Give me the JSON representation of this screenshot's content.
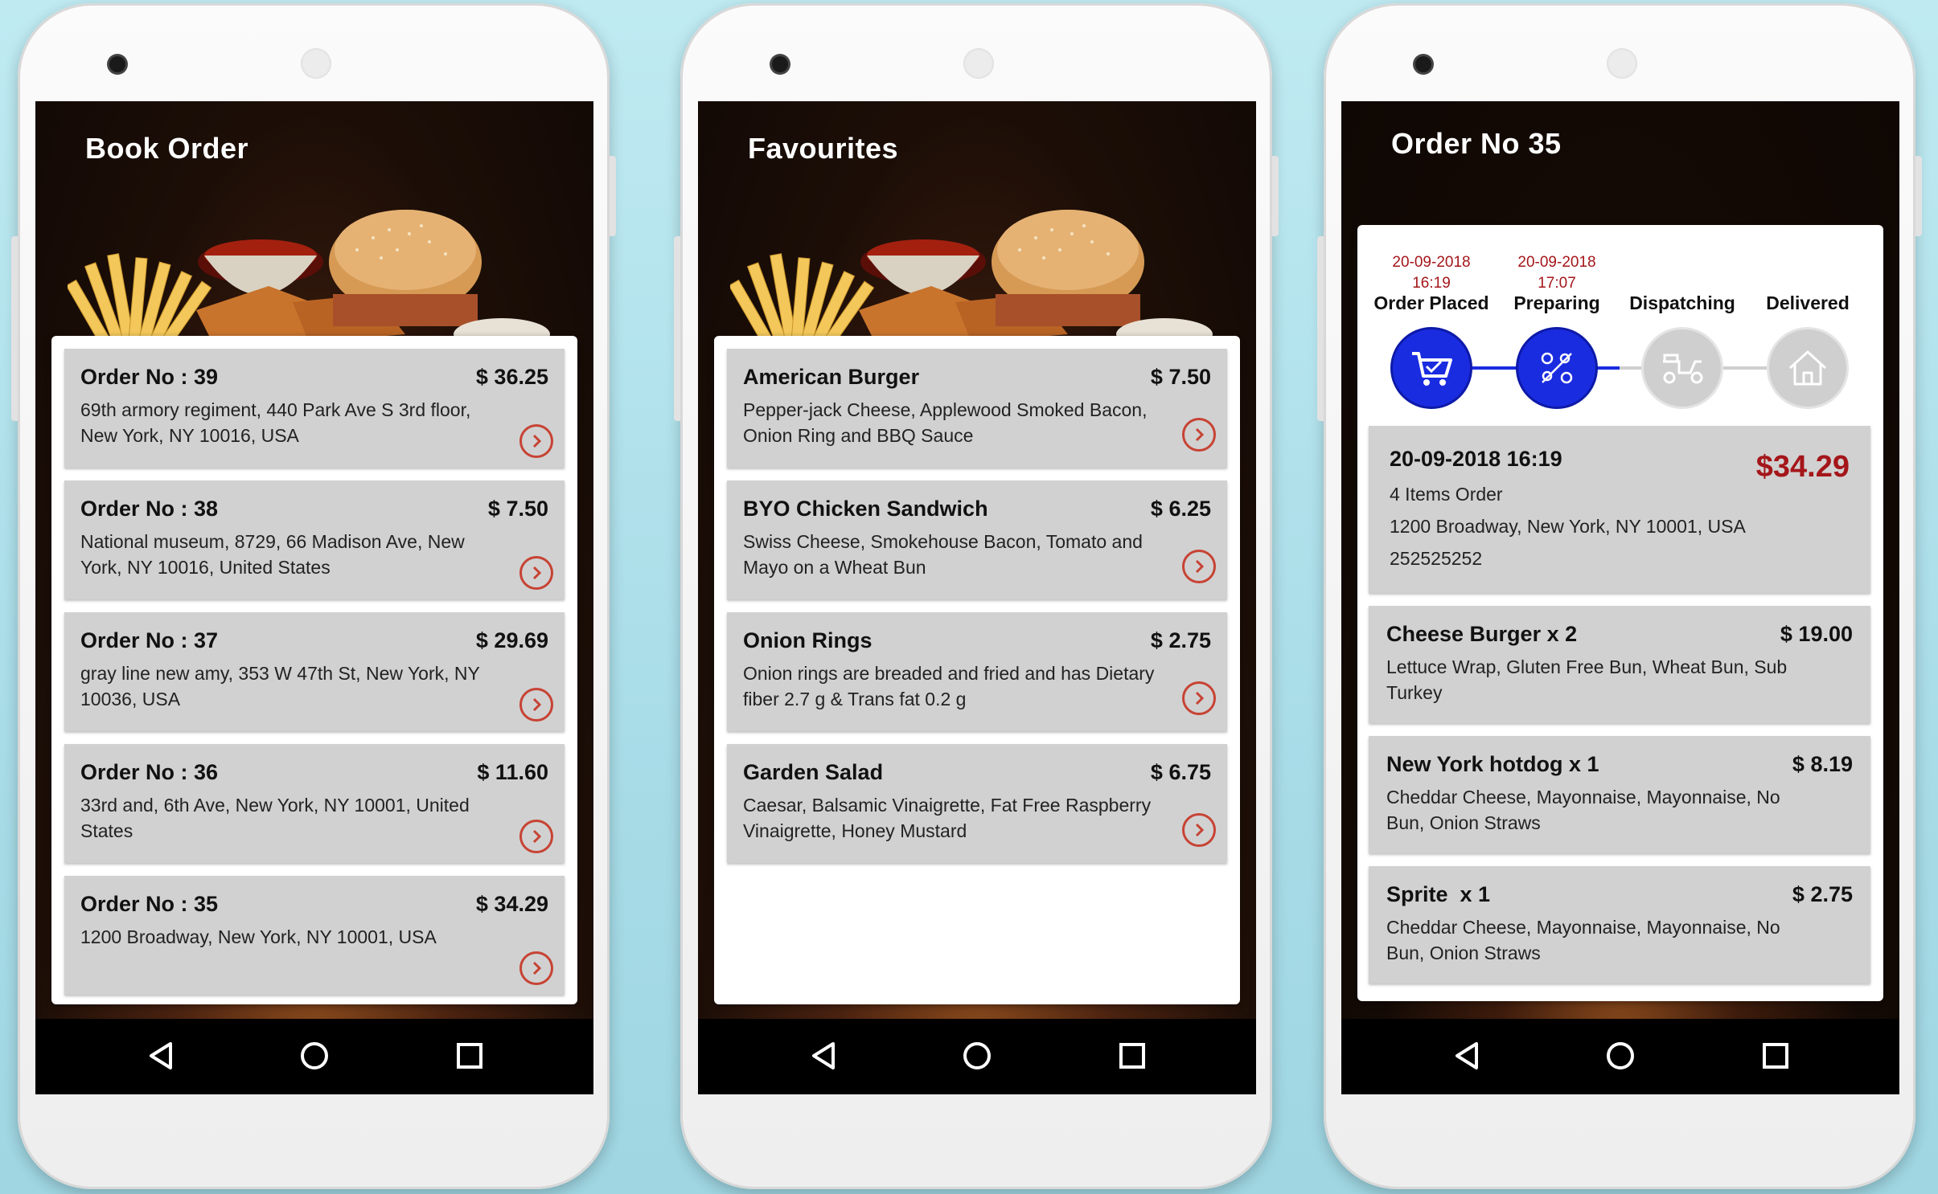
{
  "screens": {
    "book_order": {
      "title": "Book Order",
      "orders": [
        {
          "title": "Order No : 39",
          "price": "$ 36.25",
          "address": "69th armory regiment, 440 Park Ave S 3rd floor, New York, NY 10016, USA"
        },
        {
          "title": "Order No : 38",
          "price": "$ 7.50",
          "address": "National museum, 8729, 66 Madison Ave, New York, NY 10016, United States"
        },
        {
          "title": "Order No : 37",
          "price": "$ 29.69",
          "address": "gray line new amy, 353 W 47th St, New York, NY 10036, USA"
        },
        {
          "title": "Order No : 36",
          "price": "$ 11.60",
          "address": "33rd and, 6th Ave, New York, NY 10001, United States"
        },
        {
          "title": "Order No : 35",
          "price": "$ 34.29",
          "address": "1200 Broadway, New York, NY 10001, USA"
        }
      ]
    },
    "favourites": {
      "title": "Favourites",
      "items": [
        {
          "title": "American Burger",
          "price": "$ 7.50",
          "desc": "Pepper-jack Cheese, Applewood Smoked Bacon, Onion Ring and BBQ Sauce"
        },
        {
          "title": "BYO Chicken Sandwich",
          "price": "$ 6.25",
          "desc": "Swiss Cheese, Smokehouse Bacon, Tomato and Mayo on a Wheat Bun"
        },
        {
          "title": "Onion Rings",
          "price": "$ 2.75",
          "desc": "Onion rings are breaded and fried and has Dietary fiber 2.7 g & Trans fat 0.2 g"
        },
        {
          "title": "Garden Salad",
          "price": "$ 6.75",
          "desc": "Caesar, Balsamic Vinaigrette, Fat Free Raspberry Vinaigrette, Honey Mustard"
        }
      ]
    },
    "order_detail": {
      "title": "Order No 35",
      "steps": [
        {
          "date": "20-09-2018",
          "time": "16:19",
          "label": "Order Placed",
          "state": "done",
          "icon": "cart-icon"
        },
        {
          "date": "20-09-2018",
          "time": "17:07",
          "label": "Preparing",
          "state": "done",
          "icon": "cooking-icon"
        },
        {
          "date": "",
          "time": "",
          "label": "Dispatching",
          "state": "pending",
          "icon": "scooter-icon"
        },
        {
          "date": "",
          "time": "",
          "label": "Delivered",
          "state": "pending",
          "icon": "home-icon"
        }
      ],
      "summary": {
        "datetime": "20-09-2018 16:19",
        "total": "$34.29",
        "items_count": "4 Items Order",
        "address": "1200 Broadway, New York, NY 10001, USA",
        "phone": "252525252"
      },
      "items": [
        {
          "title": "Cheese Burger x 2",
          "price": "$ 19.00",
          "desc": "Lettuce Wrap, Gluten Free Bun, Wheat Bun, Sub Turkey"
        },
        {
          "title": "New York hotdog x 1",
          "price": "$ 8.19",
          "desc": "Cheddar Cheese, Mayonnaise, Mayonnaise, No Bun, Onion Straws"
        },
        {
          "title": "Sprite  x 1",
          "price": "$ 2.75",
          "desc": "Cheddar Cheese, Mayonnaise, Mayonnaise, No Bun, Onion Straws"
        }
      ]
    }
  },
  "colors": {
    "accent_red": "#c74334",
    "price_red": "#a4161a",
    "step_active": "#1a2ce0",
    "step_inactive": "#cfcfcf",
    "card_item": "#d1d1d1"
  },
  "navbar": {
    "back_icon": "back-triangle-icon",
    "home_icon": "home-circle-icon",
    "recents_icon": "recents-square-icon"
  }
}
